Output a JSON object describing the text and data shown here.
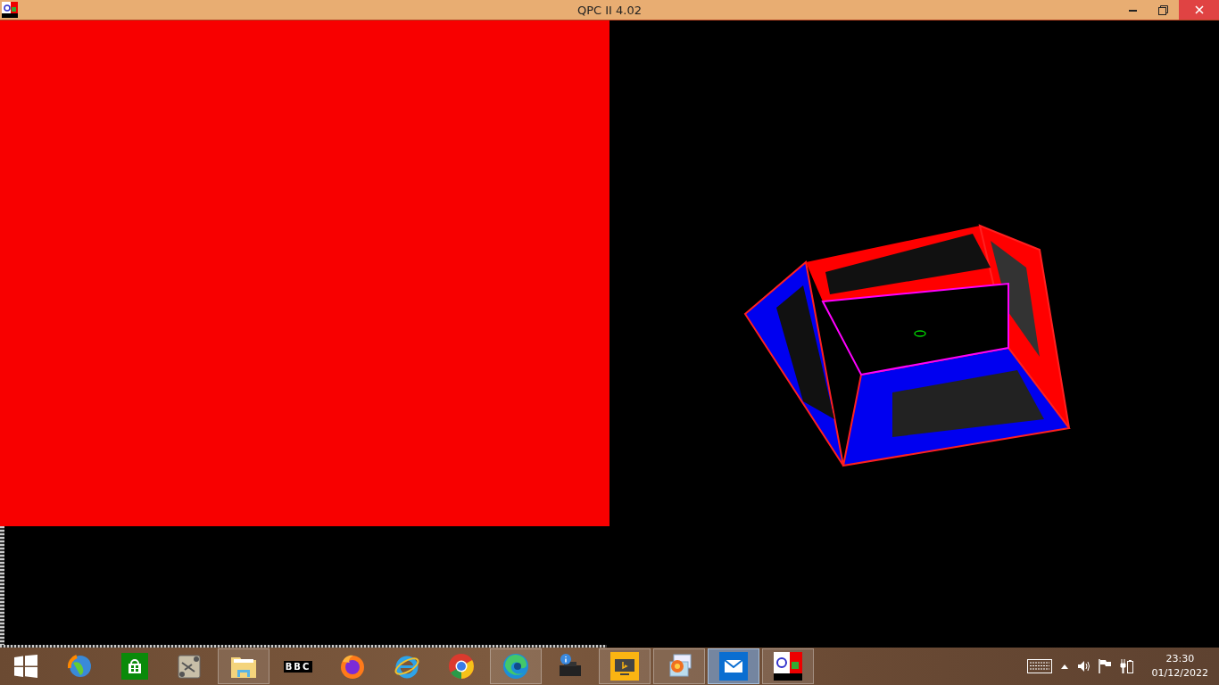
{
  "window": {
    "title": "QPC II 4.02"
  },
  "taskbar": {
    "items": [
      {
        "kind": "start",
        "open": false,
        "selected": false
      },
      {
        "kind": "globe",
        "open": false,
        "selected": false
      },
      {
        "kind": "store",
        "open": false,
        "selected": false
      },
      {
        "kind": "notes",
        "open": false,
        "selected": false
      },
      {
        "kind": "folder",
        "open": true,
        "selected": false
      },
      {
        "kind": "bbc",
        "label": "BBC",
        "open": false,
        "selected": false
      },
      {
        "kind": "firefox",
        "open": false,
        "selected": false
      },
      {
        "kind": "ie",
        "open": false,
        "selected": false
      },
      {
        "kind": "chrome",
        "open": false,
        "selected": false
      },
      {
        "kind": "edge",
        "open": true,
        "selected": false
      },
      {
        "kind": "printer",
        "open": false,
        "selected": false
      },
      {
        "kind": "bing",
        "open": true,
        "selected": false
      },
      {
        "kind": "photos",
        "open": true,
        "selected": false
      },
      {
        "kind": "mail",
        "open": true,
        "selected": true
      },
      {
        "kind": "qpc",
        "open": true,
        "selected": false
      }
    ],
    "clock": {
      "time": "23:30",
      "date": "01/12/2022"
    }
  }
}
